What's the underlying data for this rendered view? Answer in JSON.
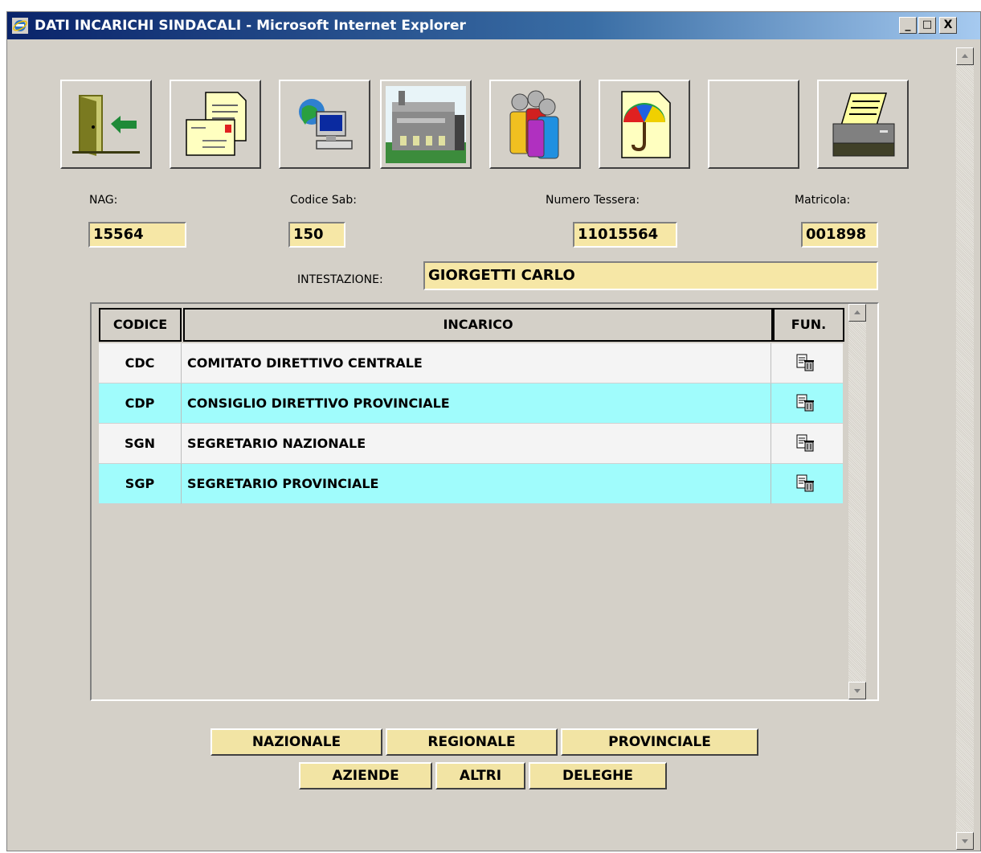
{
  "window": {
    "title": "DATI INCARICHI SINDACALI - Microsoft Internet Explorer",
    "minimize": "_",
    "maximize": "□",
    "close": "X"
  },
  "toolbar": {
    "buttons": [
      {
        "icon": "exit-door-icon"
      },
      {
        "icon": "letter-envelope-icon"
      },
      {
        "icon": "network-computer-icon"
      },
      {
        "icon": "factory-building-icon"
      },
      {
        "icon": "people-group-icon"
      },
      {
        "icon": "umbrella-document-icon"
      },
      {
        "icon": "blank-icon"
      },
      {
        "icon": "printer-icon"
      }
    ]
  },
  "fields": {
    "nag_label": "NAG:",
    "nag_value": "15564",
    "codice_sab_label": "Codice Sab:",
    "codice_sab_value": "150",
    "numero_tessera_label": "Numero Tessera:",
    "numero_tessera_value": "11015564",
    "matricola_label": "Matricola:",
    "matricola_value": "001898",
    "intestazione_label": "INTESTAZIONE:",
    "intestazione_value": "GIORGETTI CARLO"
  },
  "grid": {
    "columns": [
      "CODICE",
      "INCARICO",
      "FUN."
    ],
    "rows": [
      {
        "codice": "CDC",
        "incarico": "COMITATO DIRETTIVO CENTRALE",
        "bg": "#f4f4f4"
      },
      {
        "codice": "CDP",
        "incarico": "CONSIGLIO DIRETTIVO PROVINCIALE",
        "bg": "#a0fcfc"
      },
      {
        "codice": "SGN",
        "incarico": "SEGRETARIO NAZIONALE",
        "bg": "#f4f4f4"
      },
      {
        "codice": "SGP",
        "incarico": "SEGRETARIO PROVINCIALE",
        "bg": "#a0fcfc"
      }
    ]
  },
  "buttons": {
    "nazionale": "NAZIONALE",
    "regionale": "REGIONALE",
    "provinciale": "PROVINCIALE",
    "aziende": "AZIENDE",
    "altri": "ALTRI",
    "deleghe": "DELEGHE"
  },
  "colors": {
    "field_bg": "#f6e7a6",
    "button_bg": "#f2e4a4",
    "row_alt": "#a0fcfc",
    "row_base": "#f4f4f4"
  }
}
